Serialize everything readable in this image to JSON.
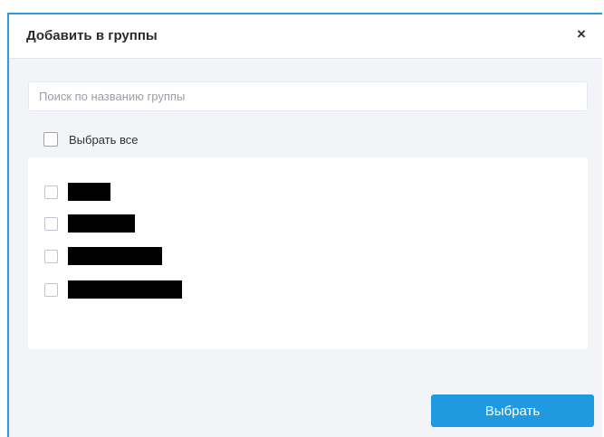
{
  "dialog": {
    "title": "Добавить в группы",
    "close_label": "×"
  },
  "search": {
    "placeholder": "Поиск по названию группы",
    "value": ""
  },
  "select_all": {
    "label": "Выбрать все",
    "checked": false
  },
  "groups": [
    {
      "label": "",
      "checked": false,
      "redacted": true
    },
    {
      "label": "",
      "checked": false,
      "redacted": true
    },
    {
      "label": "",
      "checked": false,
      "redacted": true
    },
    {
      "label": "",
      "checked": false,
      "redacted": true
    }
  ],
  "actions": {
    "submit_label": "Выбрать"
  },
  "colors": {
    "accent": "#1f9ae0",
    "border_accent": "#2d9be0",
    "background": "#f2f4f7",
    "redaction": "#000000"
  }
}
